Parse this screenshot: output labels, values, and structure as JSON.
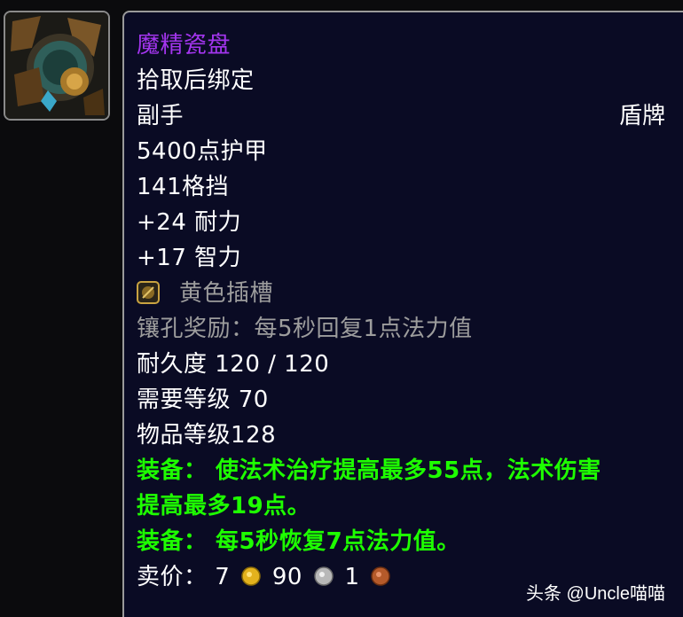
{
  "item": {
    "name": "魔精瓷盘",
    "binding": "拾取后绑定",
    "slot": "副手",
    "type": "盾牌",
    "armor": "5400点护甲",
    "block": "141格挡",
    "stat1": "+24 耐力",
    "stat2": "+17 智力",
    "socket": "黄色插槽",
    "socket_bonus": "镶孔奖励：每5秒回复1点法力值",
    "durability": "耐久度 120 / 120",
    "req_level": "需要等级 70",
    "item_level": "物品等级128",
    "equip1_line1": "装备：  使法术治疗提高最多55点，法术伤害",
    "equip1_line2": "提高最多19点。",
    "equip2": "装备：  每5秒恢复7点法力值。",
    "sell_label": "卖价：",
    "gold": "7",
    "silver": "90",
    "copper": "1"
  },
  "watermark": "头条 @Uncle喵喵",
  "colors": {
    "epic": "#a335ee",
    "green": "#1eff00",
    "grey": "#9d9d9d",
    "tooltip_bg": "#0a0b24"
  },
  "icons": {
    "item_icon": "shield-item-icon",
    "socket_icon": "yellow-socket-icon",
    "gold_icon": "gold-coin-icon",
    "silver_icon": "silver-coin-icon",
    "copper_icon": "copper-coin-icon"
  }
}
